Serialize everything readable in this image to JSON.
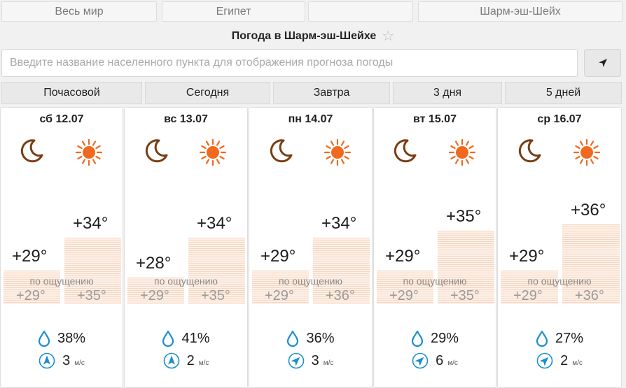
{
  "breadcrumbs": [
    "Весь мир",
    "Египет",
    "",
    "Шарм-эш-Шейх"
  ],
  "title": "Погода в Шарм-эш-Шейхе",
  "search": {
    "placeholder": "Введите название населенного пункта для отображения прогноза погоды",
    "value": ""
  },
  "tabs": [
    "Почасовой",
    "Сегодня",
    "Завтра",
    "3 дня",
    "5 дней"
  ],
  "feels_like_label": "по ощущению",
  "wind_unit": "м/с",
  "colors": {
    "sun": "#f0691e",
    "moon": "#7a3c13",
    "drop": "#1a8fd0",
    "wind": "#1a8fd0"
  },
  "icons": {
    "night": "moon-icon",
    "day": "sun-icon",
    "precip": "drop-icon",
    "wind": "wind-arrow-icon",
    "locate": "location-arrow-icon",
    "favorite": "star-icon"
  },
  "days": [
    {
      "label": "сб 12.07",
      "night": "+29°",
      "day": "+34°",
      "night_feels": "+29°",
      "day_feels": "+35°",
      "night_temp": 29,
      "day_temp": 34,
      "precip": "38%",
      "wind": "3",
      "wind_dir_deg": 0
    },
    {
      "label": "вс 13.07",
      "night": "+28°",
      "day": "+34°",
      "night_feels": "+29°",
      "day_feels": "+35°",
      "night_temp": 28,
      "day_temp": 34,
      "precip": "41%",
      "wind": "2",
      "wind_dir_deg": 0
    },
    {
      "label": "пн 14.07",
      "night": "+29°",
      "day": "+34°",
      "night_feels": "+29°",
      "day_feels": "+36°",
      "night_temp": 29,
      "day_temp": 34,
      "precip": "36%",
      "wind": "3",
      "wind_dir_deg": 45
    },
    {
      "label": "вт 15.07",
      "night": "+29°",
      "day": "+35°",
      "night_feels": "+29°",
      "day_feels": "+35°",
      "night_temp": 29,
      "day_temp": 35,
      "precip": "29%",
      "wind": "6",
      "wind_dir_deg": 45
    },
    {
      "label": "ср 16.07",
      "night": "+29°",
      "day": "+36°",
      "night_feels": "+29°",
      "day_feels": "+36°",
      "night_temp": 29,
      "day_temp": 36,
      "precip": "27%",
      "wind": "2",
      "wind_dir_deg": 45
    }
  ]
}
